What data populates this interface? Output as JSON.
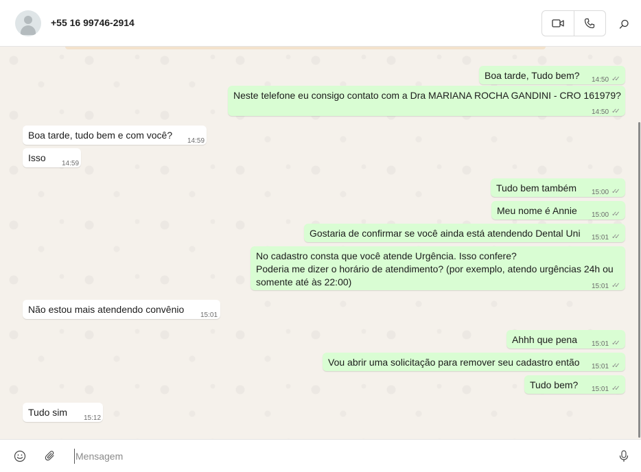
{
  "header": {
    "contact_name": "+55 16 99746-2914"
  },
  "icons": {
    "avatar": "default-person-avatar",
    "video": "video-camera-icon",
    "voice": "phone-icon",
    "search": "search-icon",
    "emoji": "smiley-icon",
    "attach": "paperclip-icon",
    "mic": "microphone-icon"
  },
  "colors": {
    "outgoing_bubble": "#d9fdd3",
    "incoming_bubble": "#ffffff",
    "chat_background": "#f5f1eb"
  },
  "messages": [
    {
      "direction": "out",
      "lines": [
        "Boa tarde, Tudo bem?"
      ],
      "time": "14:50",
      "ticks": "✓✓"
    },
    {
      "direction": "out",
      "lines": [
        "Neste telefone eu consigo contato com a Dra MARIANA ROCHA GANDINI - CRO 161979?"
      ],
      "time": "14:50",
      "ticks": "✓✓"
    },
    {
      "direction": "in",
      "lines": [
        "Boa tarde, tudo bem e com você?"
      ],
      "time": "14:59"
    },
    {
      "direction": "in",
      "lines": [
        "Isso"
      ],
      "time": "14:59"
    },
    {
      "direction": "out",
      "lines": [
        "Tudo bem também"
      ],
      "time": "15:00",
      "ticks": "✓✓"
    },
    {
      "direction": "out",
      "lines": [
        "Meu nome é Annie"
      ],
      "time": "15:00",
      "ticks": "✓✓"
    },
    {
      "direction": "out",
      "lines": [
        "Gostaria de confirmar se você ainda está atendendo Dental Uni"
      ],
      "time": "15:01",
      "ticks": "✓✓"
    },
    {
      "direction": "out",
      "lines": [
        "No cadastro consta que você atende Urgência. Isso confere?",
        "Poderia me dizer o horário de atendimento? (por exemplo, atendo urgências 24h ou",
        "somente até às 22:00)"
      ],
      "time": "15:01",
      "ticks": "✓✓"
    },
    {
      "direction": "in",
      "lines": [
        "Não estou mais atendendo convênio"
      ],
      "time": "15:01"
    },
    {
      "direction": "out",
      "lines": [
        "Ahhh que pena"
      ],
      "time": "15:01",
      "ticks": "✓✓"
    },
    {
      "direction": "out",
      "lines": [
        "Vou abrir uma solicitação para remover seu cadastro então"
      ],
      "time": "15:01",
      "ticks": "✓✓"
    },
    {
      "direction": "out",
      "lines": [
        "Tudo bem?"
      ],
      "time": "15:01",
      "ticks": "✓✓"
    },
    {
      "direction": "in",
      "lines": [
        "Tudo sim"
      ],
      "time": "15:12"
    }
  ],
  "composer": {
    "placeholder": "Mensagem"
  }
}
